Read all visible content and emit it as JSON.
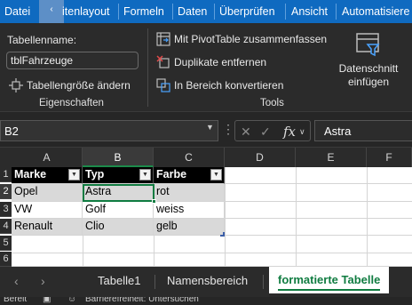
{
  "ribbon_tabs": [
    "Datei",
    "itenlayout",
    "Formeln",
    "Daten",
    "Überprüfen",
    "Ansicht",
    "Automatisiere"
  ],
  "ribbon": {
    "table_name_label": "Tabellenname:",
    "table_name_value": "tblFahrzeuge",
    "resize_label": "Tabellengröße ändern",
    "group_properties": "Eigenschaften",
    "pivot_label": "Mit PivotTable zusammenfassen",
    "remove_dup_label": "Duplikate entfernen",
    "convert_label": "In Bereich konvertieren",
    "group_tools": "Tools",
    "slicer_label_1": "Datenschnitt",
    "slicer_label_2": "einfügen"
  },
  "formula_bar": {
    "name_box": "B2",
    "fx": "fx",
    "content": "Astra"
  },
  "columns": [
    "A",
    "B",
    "C",
    "D",
    "E",
    "F"
  ],
  "rows": [
    "1",
    "2",
    "3",
    "4",
    "5",
    "6"
  ],
  "table": {
    "headers": [
      "Marke",
      "Typ",
      "Farbe"
    ],
    "rows": [
      [
        "Opel",
        "Astra",
        "rot"
      ],
      [
        "VW",
        "Golf",
        "weiss"
      ],
      [
        "Renault",
        "Clio",
        "gelb"
      ]
    ]
  },
  "sheets": {
    "tabs": [
      "Tabelle1",
      "Namensbereich",
      "formatierte Tabelle"
    ],
    "active": "formatierte Tabelle"
  },
  "status": {
    "ready": "Bereit",
    "accessibility": "Barrierefreiheit: Untersuchen"
  },
  "colors": {
    "tab_bar": "#0f6ac0",
    "accent_green": "#107c41",
    "table_header": "#000000",
    "band_row": "#d9d9d9"
  }
}
